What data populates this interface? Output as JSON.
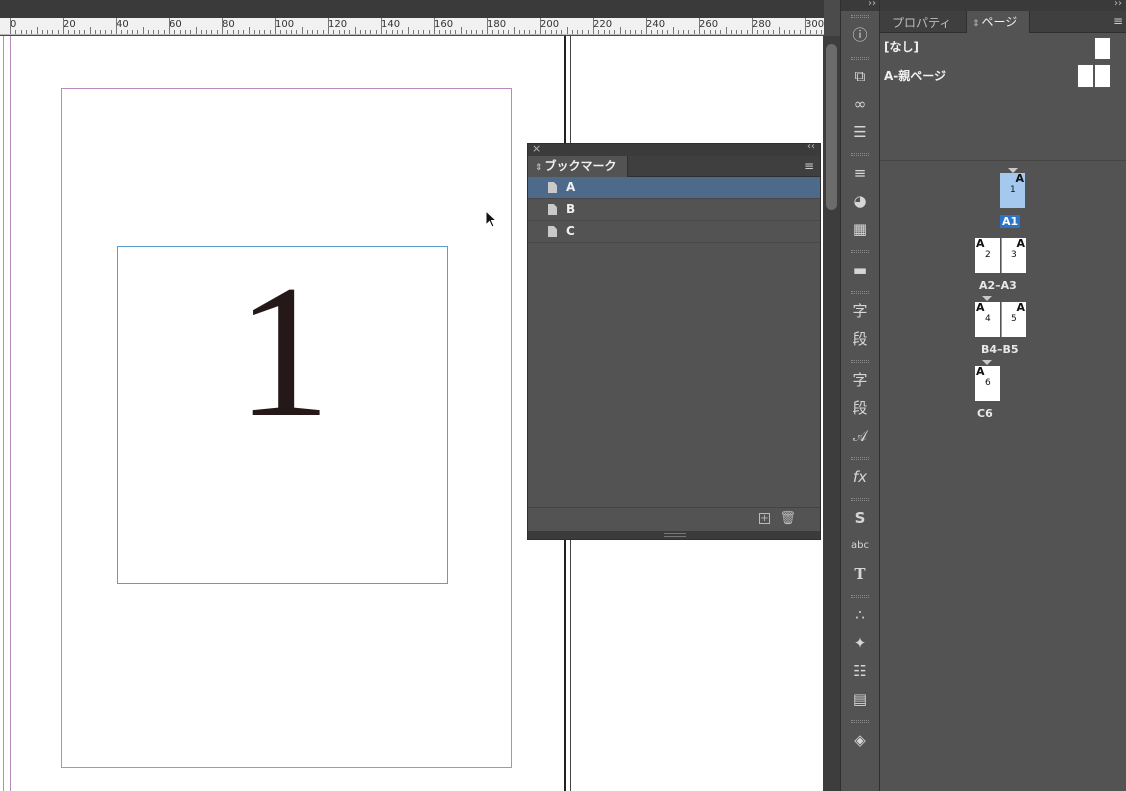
{
  "ruler": {
    "labels": [
      "0",
      "20",
      "40",
      "60",
      "80",
      "100",
      "120",
      "140",
      "160",
      "180",
      "200",
      "220",
      "240",
      "260",
      "280",
      "300"
    ]
  },
  "document": {
    "page_number": "1"
  },
  "bookmarks_panel": {
    "tab_label": "ブックマーク",
    "close_label": "×",
    "collapse_label": "‹‹",
    "menu_label": "≡",
    "items": [
      {
        "label": "A",
        "selected": true
      },
      {
        "label": "B",
        "selected": false
      },
      {
        "label": "C",
        "selected": false
      }
    ],
    "new_label": "+",
    "trash_label": "🗑"
  },
  "tools": {
    "collapse_label": "››",
    "icons": [
      {
        "name": "info-icon",
        "glyph": "ⓘ"
      },
      {
        "name": "links-frame-icon",
        "glyph": "⧉"
      },
      {
        "name": "hyperlinks-icon",
        "glyph": "∞"
      },
      {
        "name": "text-wrap-icon",
        "glyph": "☰"
      },
      {
        "name": "stroke-icon",
        "glyph": "≡"
      },
      {
        "name": "color-palette-icon",
        "glyph": "◕"
      },
      {
        "name": "swatches-icon",
        "glyph": "▦"
      },
      {
        "name": "gradient-icon",
        "glyph": "▬"
      },
      {
        "name": "character-styles-icon",
        "glyph": "字"
      },
      {
        "name": "paragraph-styles-icon",
        "glyph": "段"
      },
      {
        "name": "character-icon",
        "glyph": "字"
      },
      {
        "name": "paragraph-icon",
        "glyph": "段"
      },
      {
        "name": "glyphs-icon",
        "glyph": "𝒜"
      },
      {
        "name": "effects-icon",
        "glyph": "fx"
      },
      {
        "name": "script-icon",
        "glyph": "S"
      },
      {
        "name": "spelling-icon",
        "glyph": "abc"
      },
      {
        "name": "type-icon",
        "glyph": "T"
      },
      {
        "name": "interactive-icon",
        "glyph": "∴"
      },
      {
        "name": "animation-icon",
        "glyph": "✦"
      },
      {
        "name": "object-states-icon",
        "glyph": "☷"
      },
      {
        "name": "media-icon",
        "glyph": "▤"
      },
      {
        "name": "layers-icon",
        "glyph": "◈"
      }
    ]
  },
  "pages_panel": {
    "tab_properties": "プロパティ",
    "tab_pages": "ページ",
    "tab_pages_icon": "⇕",
    "collapse_label": "››",
    "menu_label": "≡",
    "parent_none": "[なし]",
    "parent_a": "A-親ページ",
    "spreads": [
      {
        "label": "A1",
        "selected": true,
        "pages": [
          {
            "prefix": "A",
            "num": "1"
          }
        ]
      },
      {
        "label": "A2–A3",
        "selected": false,
        "pages": [
          {
            "prefix": "A",
            "num": "2"
          },
          {
            "prefix": "A",
            "num": "3"
          }
        ]
      },
      {
        "label": "B4–B5",
        "selected": false,
        "pages": [
          {
            "prefix": "A",
            "num": "4"
          },
          {
            "prefix": "A",
            "num": "5"
          }
        ]
      },
      {
        "label": "C6",
        "selected": false,
        "pages": [
          {
            "prefix": "A",
            "num": "6"
          }
        ]
      }
    ]
  }
}
